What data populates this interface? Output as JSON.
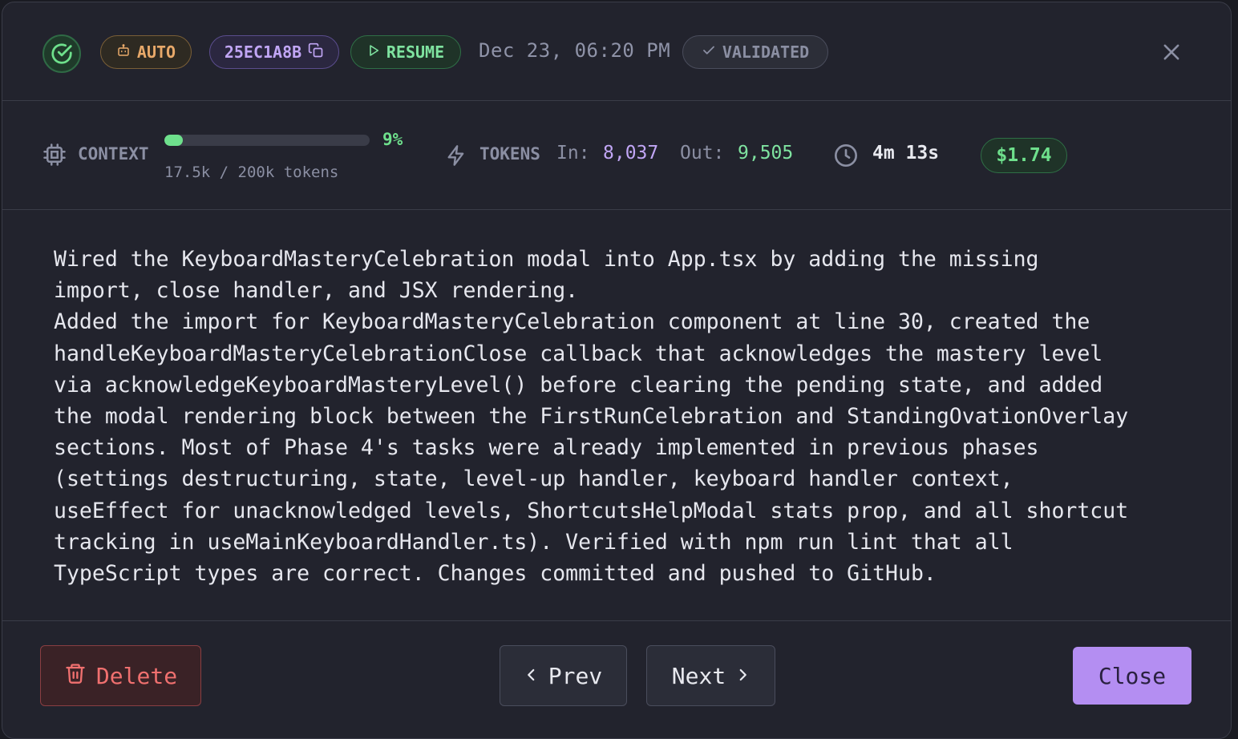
{
  "header": {
    "status_icon": "check-circle-icon",
    "auto_label": "AUTO",
    "session_id": "25EC1A8B",
    "resume_label": "RESUME",
    "date": "Dec 23, 06:20 PM",
    "validated_label": "VALIDATED"
  },
  "stats": {
    "context_label": "CONTEXT",
    "context_percent": "9%",
    "context_fraction": 0.09,
    "context_tokens": "17.5k / 200k tokens",
    "tokens_label": "TOKENS",
    "in_label": "In:",
    "in_value": "8,037",
    "out_label": "Out:",
    "out_value": "9,505",
    "duration": "4m 13s",
    "cost": "$1.74"
  },
  "summary": "Wired the KeyboardMasteryCelebration modal into App.tsx by adding the missing\nimport, close handler, and JSX rendering.\nAdded the import for KeyboardMasteryCelebration component at line 30, created the\nhandleKeyboardMasteryCelebrationClose callback that acknowledges the mastery level\nvia acknowledgeKeyboardMasteryLevel() before clearing the pending state, and added\nthe modal rendering block between the FirstRunCelebration and StandingOvationOverlay\nsections. Most of Phase 4's tasks were already implemented in previous phases\n(settings destructuring, state, level-up handler, keyboard handler context,\nuseEffect for unacknowledged levels, ShortcutsHelpModal stats prop, and all shortcut\ntracking in useMainKeyboardHandler.ts). Verified with npm run lint that all\nTypeScript types are correct. Changes committed and pushed to GitHub.",
  "footer": {
    "delete_label": "Delete",
    "prev_label": "Prev",
    "next_label": "Next",
    "close_label": "Close"
  },
  "colors": {
    "background": "#22232d",
    "accent_purple": "#b48ef2",
    "success_green": "#6ee08c",
    "danger_red": "#f0706f",
    "warning_orange": "#e8a96a"
  }
}
